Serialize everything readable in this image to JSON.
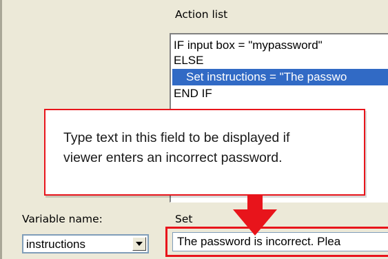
{
  "labels": {
    "action_list": "Action list",
    "variable_name": "Variable name:",
    "set": "Set"
  },
  "action_list": {
    "items": [
      "IF input box = \"mypassword\"",
      "ELSE",
      "Set instructions = \"The passwo",
      "END IF"
    ],
    "selected_index": 2
  },
  "variable_select": {
    "value": "instructions",
    "icon": "chevron-down-icon"
  },
  "set_field": {
    "value": "The password is incorrect. Plea"
  },
  "callout": {
    "text_line1": "Type text in this field to be displayed if",
    "text_line2": "viewer enters an incorrect password."
  },
  "colors": {
    "highlight": "#316ac5",
    "annotation_red": "#e8141b",
    "dialog_bg": "#ece9d8"
  }
}
